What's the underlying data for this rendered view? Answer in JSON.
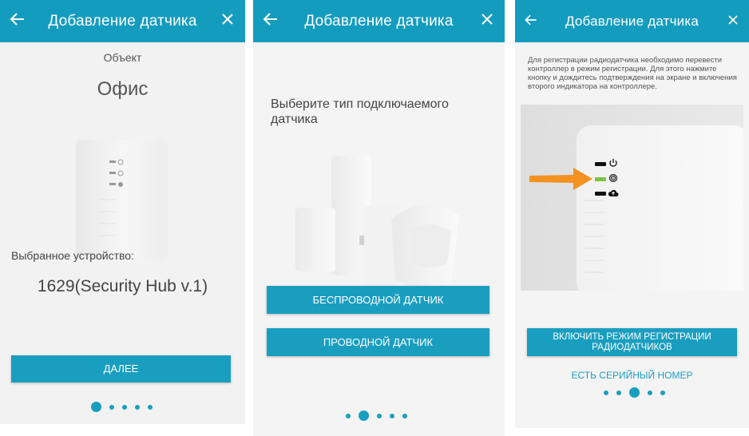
{
  "colors": {
    "accent": "#149cbf",
    "arrow": "#f39121",
    "led_green": "#7ac143"
  },
  "screen1": {
    "title": "Добавление датчика",
    "object_label": "Объект",
    "object_value": "Офис",
    "device_label": "Выбранное устройство:",
    "device_value": "1629(Security Hub v.1)",
    "next_button": "ДАЛЕЕ",
    "pager": {
      "count": 5,
      "active": 0
    }
  },
  "screen2": {
    "title": "Добавление датчика",
    "prompt": "Выберите тип подключаемого датчика",
    "wireless_button": "БЕСПРОВОДНОЙ ДАТЧИК",
    "wired_button": "ПРОВОДНОЙ ДАТЧИК",
    "pager": {
      "count": 5,
      "active": 1
    }
  },
  "screen3": {
    "title": "Добавление датчика",
    "instruction": "Для регистрации радиодатчика необходимо перевести контроллер в режим регистрации. Для этого нажмите кнопку и дождитесь подтверждения на экране и включения второго индикатора на контроллере.",
    "register_button": "ВКЛЮЧИТЬ РЕЖИМ РЕГИСТРАЦИИ РАДИОДАТЧИКОВ",
    "serial_link": "ЕСТЬ СЕРИЙНЫЙ НОМЕР",
    "pager": {
      "count": 5,
      "active": 2
    }
  },
  "icons": [
    "arrow-back-icon",
    "close-icon",
    "power-icon",
    "fingerprint-icon",
    "cloud-icon"
  ]
}
